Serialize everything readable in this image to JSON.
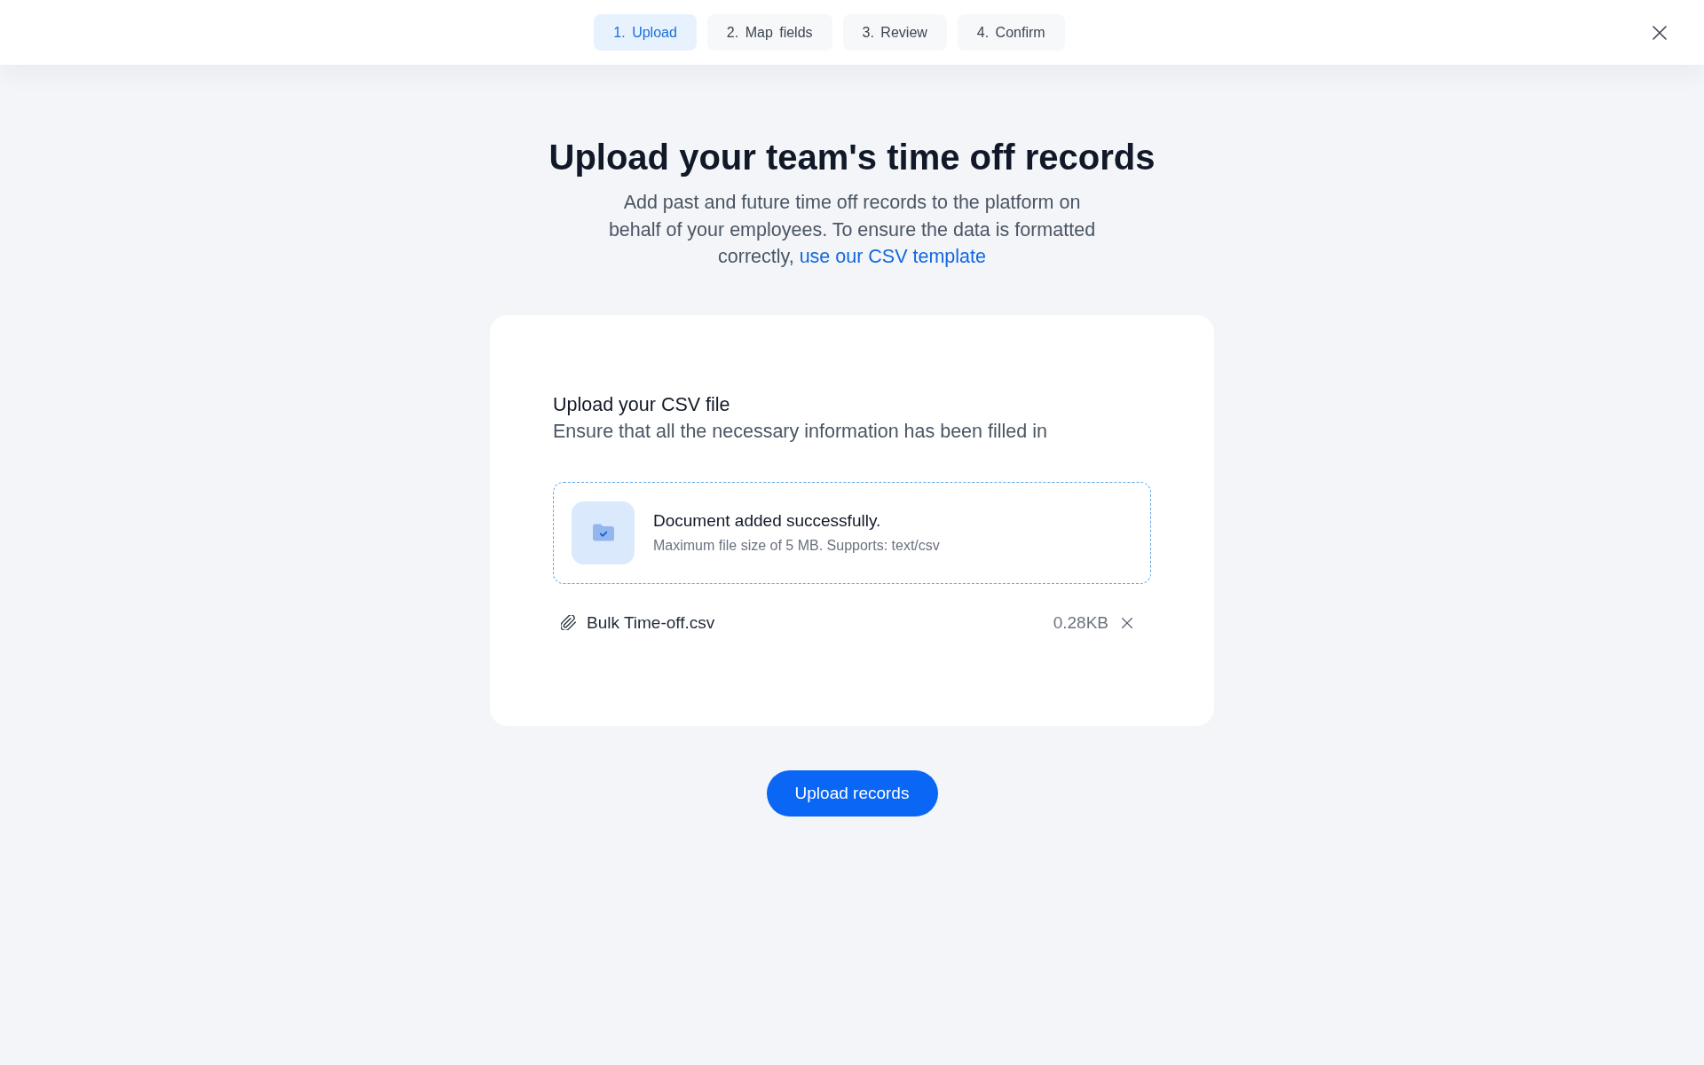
{
  "steps": [
    {
      "label": "1. Upload",
      "selected": true
    },
    {
      "label": "2. Map fields",
      "selected": false
    },
    {
      "label": "3. Review",
      "selected": false
    },
    {
      "label": "4. Confirm",
      "selected": false
    }
  ],
  "title": "Upload your team's time off records",
  "intro": {
    "text": "Add past and future time off records to the platform on behalf of your employees. To ensure the data is formatted correctly,",
    "link": "use our CSV template"
  },
  "upload_card": {
    "heading": "Upload your CSV file",
    "description": "Ensure that all the necessary information has been filled in",
    "dropzone": {
      "status": "Document added successfully.",
      "hint": "Maximum file size of 5 MB. Supports: text/csv"
    },
    "files": [
      {
        "name": "Bulk Time-off.csv",
        "size": "0.28KB"
      }
    ]
  },
  "submit_button": "Upload records"
}
